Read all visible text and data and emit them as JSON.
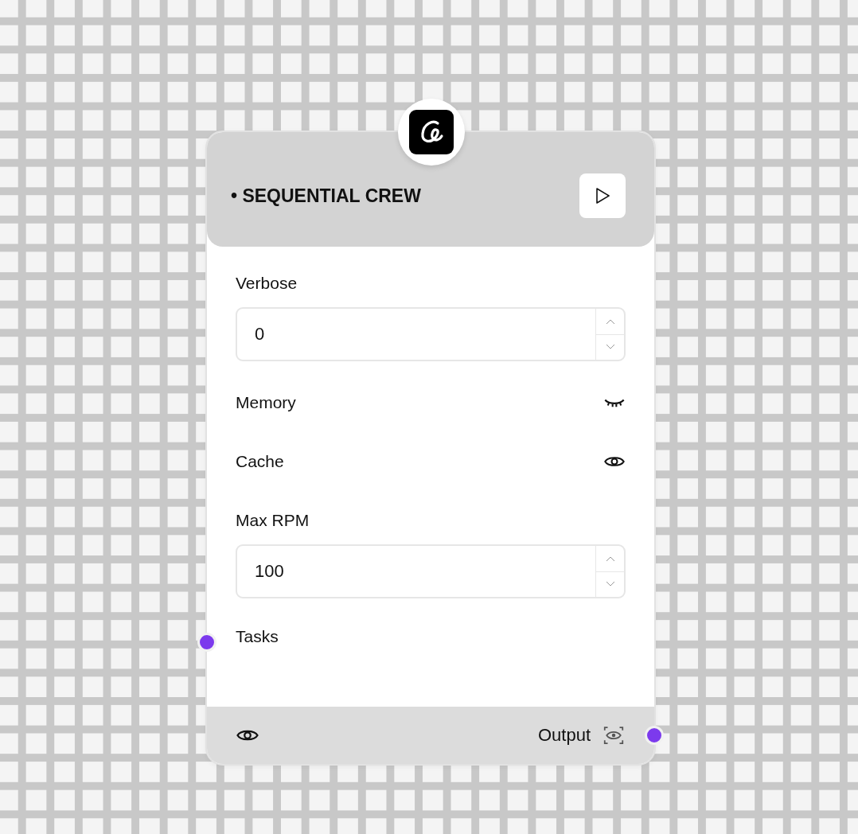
{
  "node": {
    "title": "• SEQUENTIAL CREW",
    "fields": [
      {
        "kind": "number",
        "label": "Verbose",
        "value": "0"
      },
      {
        "kind": "toggle",
        "label": "Memory",
        "visible": false
      },
      {
        "kind": "toggle",
        "label": "Cache",
        "visible": true
      },
      {
        "kind": "number",
        "label": "Max RPM",
        "value": "100"
      },
      {
        "kind": "input",
        "label": "Tasks"
      }
    ],
    "footer": {
      "output_label": "Output"
    }
  }
}
